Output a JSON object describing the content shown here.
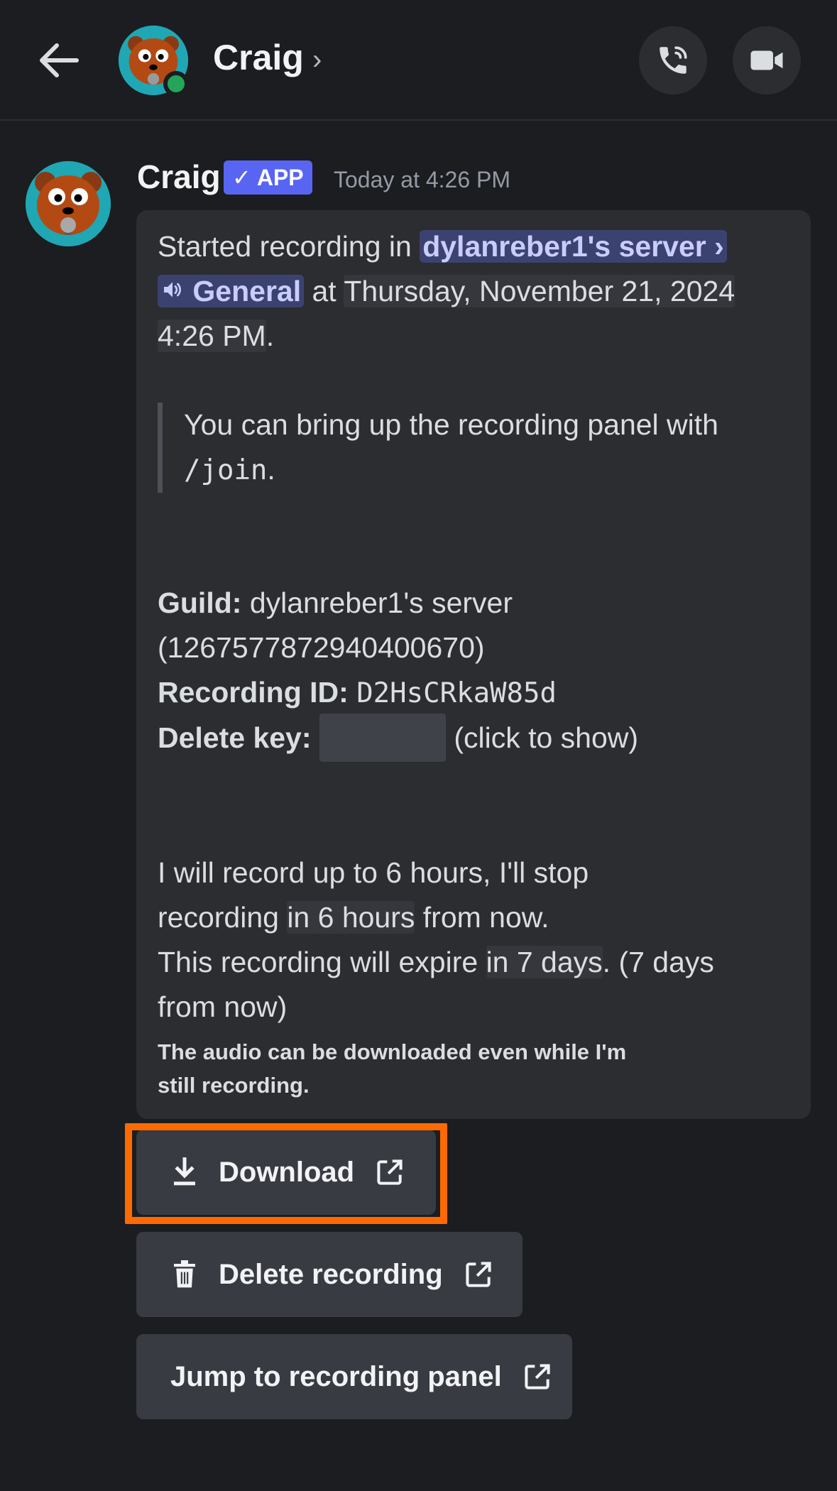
{
  "header": {
    "back_icon": "arrow-left-icon",
    "name": "Craig",
    "chevron": "›",
    "call_icon": "phone-icon",
    "video_icon": "video-camera-icon",
    "status_color": "#23a55a"
  },
  "message": {
    "author": "Craig",
    "badge_check": "✓",
    "badge": "APP",
    "timestamp": "Today at 4:26 PM",
    "line1_prefix": "Started recording in ",
    "server_mention": "dylanreber1's server",
    "server_chevron": "›",
    "channel_mention": "General",
    "at_word": " at ",
    "datetime_a": "Thursday, November 21, 2024",
    "datetime_b": "4:26 PM",
    "period": ".",
    "quote_text": "You can bring up the recording panel with ",
    "quote_cmd": "/join",
    "guild_label": "Guild:",
    "guild_value": " dylanreber1's server",
    "guild_id": "(1267577872940400670)",
    "recording_id_label": "Recording ID:",
    "recording_id": "D2HsCRkaW85d",
    "delete_key_label": "Delete key:",
    "click_to_show": "(click to show)",
    "record_line_a": "I will record up to 6 hours, I'll stop",
    "record_line_b_pre": "recording ",
    "record_line_b_ts": "in 6 hours",
    "record_line_b_post": " from now.",
    "expire_pre": "This recording will expire ",
    "expire_ts": "in 7 days",
    "expire_post": ". (7 days",
    "expire_end": "from now)",
    "footer_note_a": "The audio can be downloaded even while I'm",
    "footer_note_b": "still recording."
  },
  "buttons": {
    "download": "Download",
    "delete": "Delete recording",
    "jump": "Jump to recording panel",
    "highlight_color": "#ff6a00"
  }
}
